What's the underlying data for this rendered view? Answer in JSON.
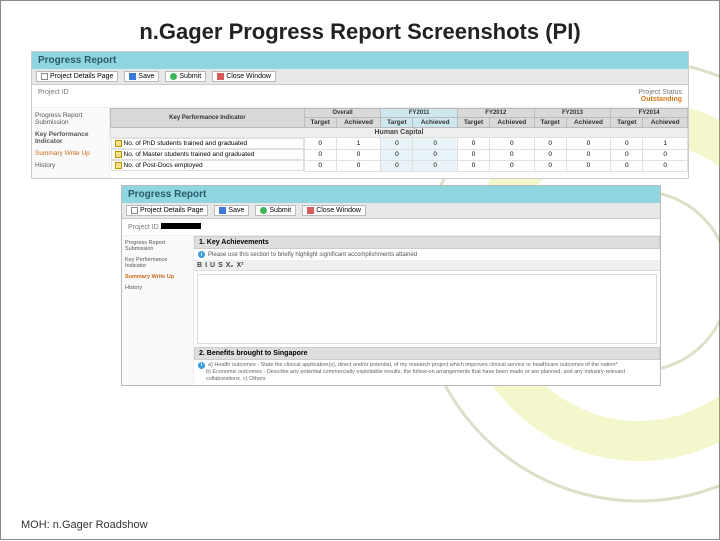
{
  "slide": {
    "title": "n.Gager Progress Report Screenshots (PI)",
    "footer": "MOH: n.Gager Roadshow"
  },
  "report1": {
    "header": "Progress Report",
    "toolbar": {
      "detailsPage": "Project Details Page",
      "save": "Save",
      "submit": "Submit",
      "close": "Close Window"
    },
    "projectIdLabel": "Project ID",
    "statusLabel": "Project Status",
    "statusValue": "Outstanding",
    "sidebar": {
      "submission": "Progress Report Submission",
      "kpi": "Key Performance Indicator",
      "summary": "Summary Write Up",
      "history": "History"
    },
    "table": {
      "group_top": [
        "Overall",
        "FY2011",
        "FY2012",
        "FY2013",
        "FY2014"
      ],
      "sub": [
        "Target",
        "Achieved"
      ],
      "kpiHeader": "Key Performance Indicator",
      "sectionLabel": "Human Capital",
      "rows": [
        {
          "label": "No. of PhD students trained and graduated",
          "overall": [
            "0",
            "1"
          ],
          "fy11": [
            "0",
            "0"
          ],
          "fy12": [
            "0",
            "0"
          ],
          "fy13": [
            "0",
            "0"
          ],
          "fy14": [
            "0",
            "1"
          ]
        },
        {
          "label": "No. of Master students trained and graduated",
          "overall": [
            "0",
            "0"
          ],
          "fy11": [
            "0",
            "0"
          ],
          "fy12": [
            "0",
            "0"
          ],
          "fy13": [
            "0",
            "0"
          ],
          "fy14": [
            "0",
            "0"
          ]
        },
        {
          "label": "No. of Post-Docs employed",
          "overall": [
            "0",
            "0"
          ],
          "fy11": [
            "0",
            "0"
          ],
          "fy12": [
            "0",
            "0"
          ],
          "fy13": [
            "0",
            "0"
          ],
          "fy14": [
            "0",
            "0"
          ]
        }
      ]
    }
  },
  "report2": {
    "header": "Progress Report",
    "toolbar": {
      "detailsPage": "Project Details Page",
      "save": "Save",
      "submit": "Submit",
      "close": "Close Window"
    },
    "projectIdLabel": "Project ID",
    "sidebar": {
      "submission": "Progress Report Submission",
      "kpi": "Key Performance Indicator",
      "summary": "Summary Write Up",
      "history": "History"
    },
    "sec1": {
      "title": "1. Key Achievements",
      "help": "Please use this section to briefly highlight significant accomplishments attained",
      "editorButtons": [
        "B",
        "I",
        "U",
        "S",
        "X₂",
        "X²"
      ]
    },
    "sec2": {
      "title": "2. Benefits brought to Singapore",
      "line_a": "a) Health outcomes - State the clinical application(s), direct and/or potential, of my research project which improves clinical service or healthcare outcomes of the nation*",
      "line_b": "b) Economic outcomes - Describe any potential commercially exploitable results, the follow-on arrangements that have been made or are planned, and any industry-relevant collaborations. c) Others"
    }
  }
}
